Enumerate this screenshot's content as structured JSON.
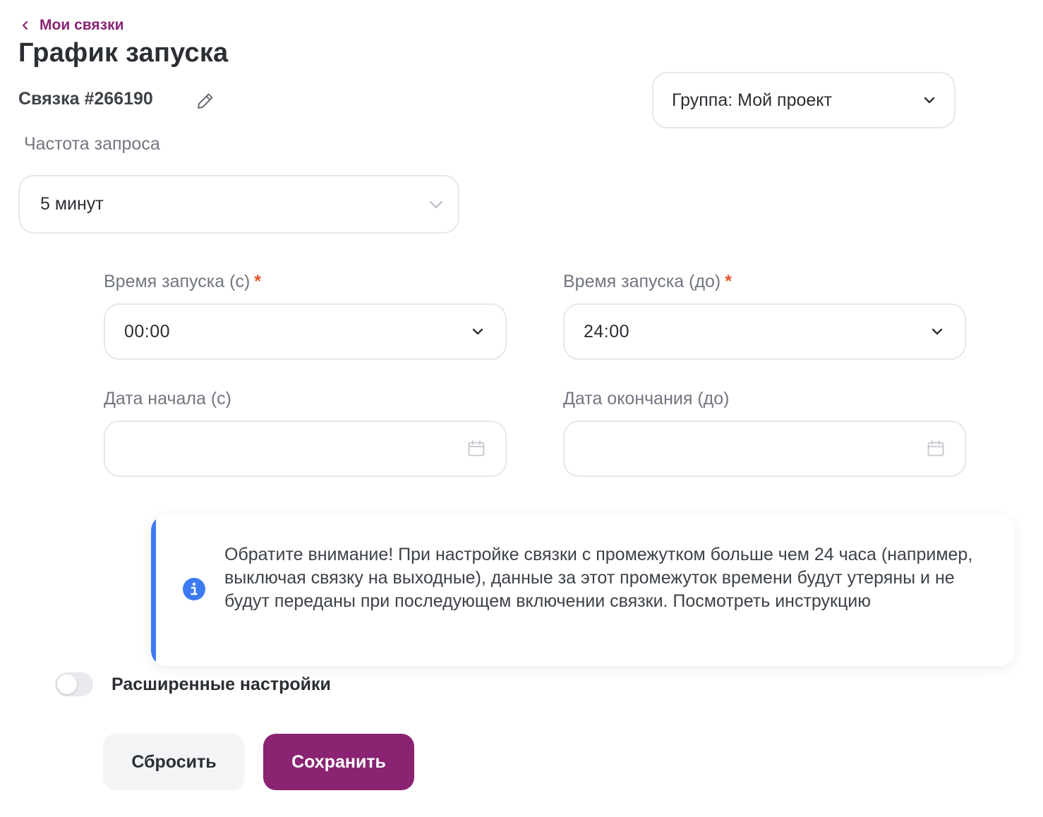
{
  "breadcrumb": {
    "back_label": "Мои связки"
  },
  "page": {
    "title": "График запуска"
  },
  "link": {
    "name": "Связка #266190"
  },
  "group_select": {
    "value": "Группа: Мой проект"
  },
  "frequency": {
    "label": "Частота запроса",
    "value": "5 минут"
  },
  "time_from": {
    "label": "Время запуска (с)",
    "required_mark": "*",
    "value": "00:00"
  },
  "time_to": {
    "label": "Время запуска (до)",
    "required_mark": "*",
    "value": "24:00"
  },
  "date_from": {
    "label": "Дата начала (с)",
    "value": ""
  },
  "date_to": {
    "label": "Дата окончания (до)",
    "value": ""
  },
  "notice": {
    "text": "Обратите внимание! При настройке связки с промежутком больше чем 24 часа (например, выключая связку на выходные), данные за этот промежуток времени будут утеряны и не будут переданы при последующем включении связки. Посмотреть инструкцию",
    "accent_color": "#3d7bf2"
  },
  "advanced": {
    "label": "Расширенные настройки",
    "enabled": false
  },
  "actions": {
    "reset_label": "Сбросить",
    "save_label": "Сохранить"
  },
  "colors": {
    "brand": "#8a2472",
    "required": "#e5532b",
    "info": "#3d7bf2"
  },
  "icons": {
    "back": "chevron-left-icon",
    "edit": "pencil-icon",
    "dropdown": "chevron-down-icon",
    "calendar": "calendar-icon",
    "info": "info-icon"
  }
}
